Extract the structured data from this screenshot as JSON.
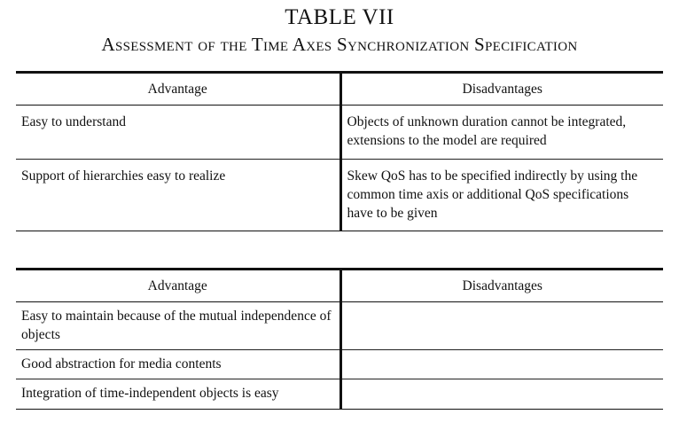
{
  "title": "TABLE VII",
  "subtitle": "Assessment of the Time Axes Synchronization Specification",
  "table1": {
    "headers": [
      "Advantage",
      "Disadvantages"
    ],
    "rows": [
      [
        "Easy to understand",
        "Objects of unknown duration cannot be integrated, extensions to the model are required"
      ],
      [
        "Support of hierarchies easy to realize",
        "Skew QoS has to be specified indirectly by using the common time axis or additional QoS specifications have to be given"
      ]
    ]
  },
  "table2": {
    "headers": [
      "Advantage",
      "Disadvantages"
    ],
    "rows": [
      [
        "Easy to maintain because of the mutual independence of objects",
        ""
      ],
      [
        "Good abstraction for media contents",
        ""
      ],
      [
        "Integration of time-independent objects is easy",
        ""
      ]
    ]
  }
}
